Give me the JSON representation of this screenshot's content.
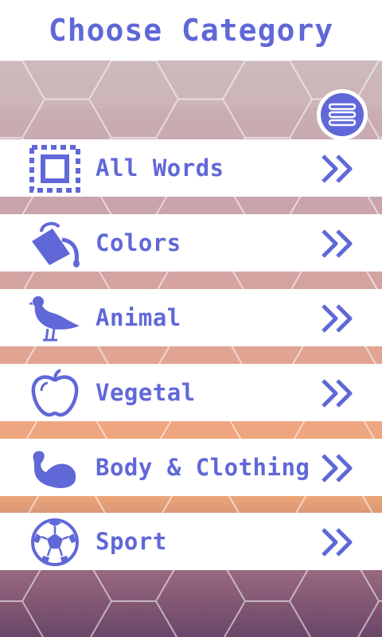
{
  "header": {
    "title": "Choose Category"
  },
  "menu": {
    "icon": "hamburger-menu-icon"
  },
  "categories": [
    {
      "label": "All Words",
      "icon": "select-all-icon"
    },
    {
      "label": "Colors",
      "icon": "paint-bucket-icon"
    },
    {
      "label": "Animal",
      "icon": "pigeon-icon"
    },
    {
      "label": "Vegetal",
      "icon": "apple-icon"
    },
    {
      "label": "Body & Clothing",
      "icon": "flexed-arm-icon"
    },
    {
      "label": "Sport",
      "icon": "soccer-ball-icon"
    }
  ],
  "colors": {
    "accent": "#6068d8",
    "row_background": "#ffffff"
  }
}
